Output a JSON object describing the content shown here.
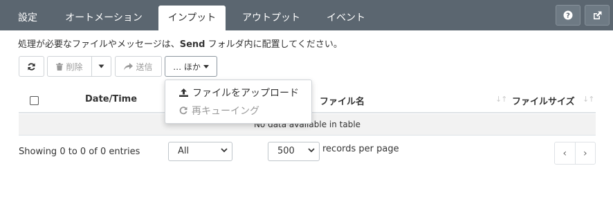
{
  "tabs": [
    {
      "label": "設定",
      "active": false
    },
    {
      "label": "オートメーション",
      "active": false
    },
    {
      "label": "インプット",
      "active": true
    },
    {
      "label": "アウトプット",
      "active": false
    },
    {
      "label": "イベント",
      "active": false
    }
  ],
  "topbar_icons": {
    "help": "question-circle-icon",
    "external": "external-link-icon"
  },
  "info": {
    "prefix": "処理が必要なファイルやメッセージは、",
    "folder": "Send",
    "suffix": " フォルダ内に配置してください。"
  },
  "toolbar": {
    "refresh_icon": "refresh-icon",
    "delete_label": "削除",
    "send_label": "送信",
    "more_label": "… ほか"
  },
  "dropdown": {
    "items": [
      {
        "label": "ファイルをアップロード",
        "icon": "upload-icon"
      },
      {
        "label": "再キューイング",
        "icon": "redo-icon",
        "disabled": true
      }
    ]
  },
  "table": {
    "columns": [
      "Date/Time",
      "ファイル名",
      "ファイルサイズ"
    ],
    "empty_message": "No data available in table"
  },
  "footer": {
    "info": "Showing 0 to 0 of 0 entries",
    "filter_value": "All",
    "page_size_value": "500",
    "page_size_label": "records per page",
    "prev": "‹",
    "next": "›"
  }
}
